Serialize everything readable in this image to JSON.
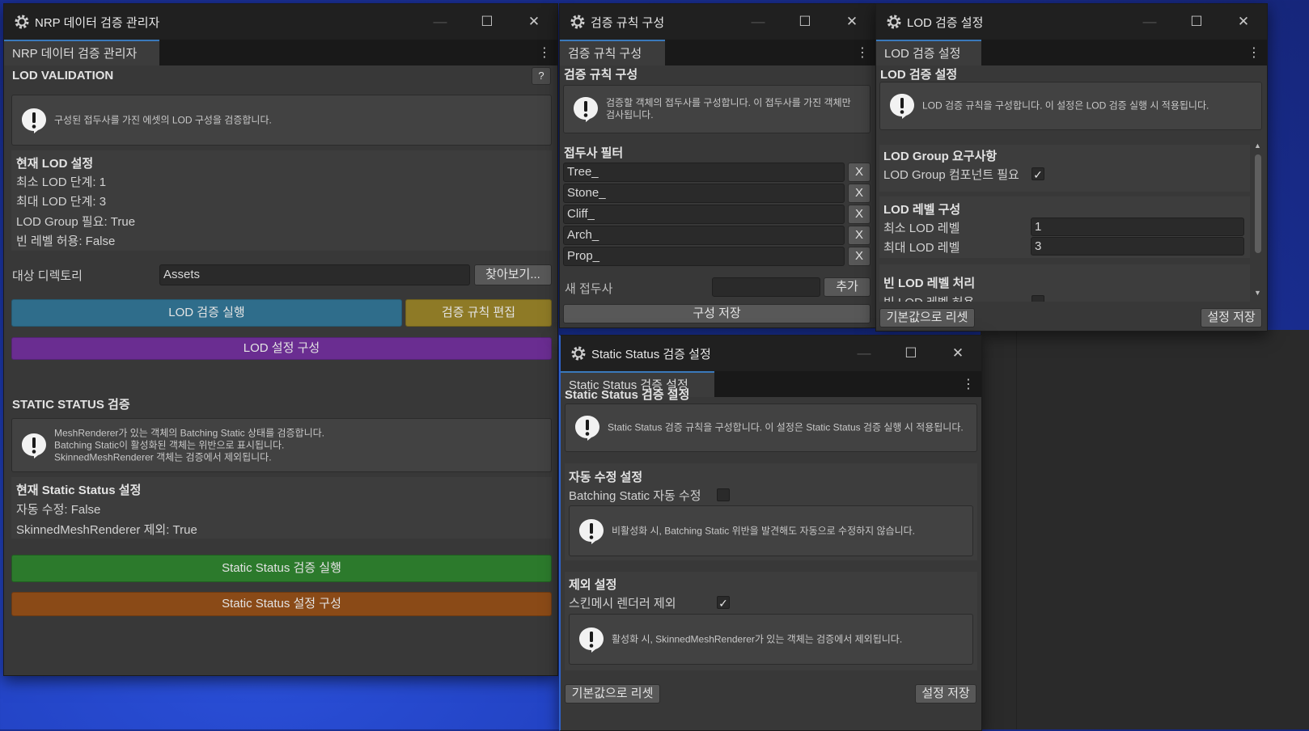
{
  "icons": {
    "app": "unity-gear-icon",
    "minimize": "minimize-icon",
    "maximize": "maximize-icon",
    "close": "close-icon",
    "menu": "kebab-menu-icon",
    "info": "exclamation-icon"
  },
  "colors": {
    "lod_run": "#2f6d8b",
    "rule_edit": "#8e7a26",
    "lod_config": "#6a2d91",
    "static_run": "#2c7a2c",
    "static_config": "#8a4a17"
  },
  "window_main": {
    "title": "NRP 데이터 검증 관리자",
    "tab": "NRP 데이터 검증 관리자",
    "lod_section": "LOD VALIDATION",
    "help_button": "?",
    "lod_info": "구성된 접두사를 가진 에셋의 LOD 구성을 검증합니다.",
    "current_lod_header": "현재 LOD 설정",
    "current_lod_lines": [
      "최소 LOD 단계: 1",
      "최대 LOD 단계: 3",
      "LOD Group 필요: True",
      "빈 레벨 허용: False"
    ],
    "target_dir_label": "대상 디렉토리",
    "target_dir_value": "Assets",
    "browse_button": "찾아보기...",
    "lod_run_button": "LOD 검증 실행",
    "rule_edit_button": "검증 규칙 편집",
    "lod_config_button": "LOD 설정 구성",
    "static_section": "STATIC STATUS 검증",
    "static_info_lines": [
      "MeshRenderer가 있는 객체의 Batching Static 상태를 검증합니다.",
      "Batching Static이 활성화된 객체는 위반으로 표시됩니다.",
      "SkinnedMeshRenderer 객체는 검증에서 제외됩니다."
    ],
    "current_static_header": "현재 Static Status 설정",
    "current_static_lines": [
      "자동 수정: False",
      "SkinnedMeshRenderer 제외: True"
    ],
    "static_run_button": "Static Status 검증 실행",
    "static_config_button": "Static Status 설정 구성"
  },
  "window_rules": {
    "title": "검증 규칙 구성",
    "tab": "검증 규칙 구성",
    "header": "검증 규칙 구성",
    "info": "검증할 객체의 접두사를 구성합니다. 이 접두사를 가진 객체만 검사됩니다.",
    "prefix_header": "접두사 필터",
    "prefixes": [
      "Tree_",
      "Stone_",
      "Cliff_",
      "Arch_",
      "Prop_"
    ],
    "remove_label": "X",
    "new_prefix_label": "새 접두사",
    "new_prefix_value": "",
    "add_button": "추가",
    "save_button": "구성 저장"
  },
  "window_lod": {
    "title": "LOD 검증 설정",
    "tab": "LOD 검증 설정",
    "header": "LOD 검증 설정",
    "info": "LOD 검증 규칙을 구성합니다. 이 설정은 LOD 검증 실행 시 적용됩니다.",
    "group_req_header": "LOD Group 요구사항",
    "group_req_label": "LOD Group 컴포넌트 필요",
    "group_req_checked": true,
    "levels_header": "LOD 레벨 구성",
    "min_label": "최소 LOD 레벨",
    "min_value": "1",
    "max_label": "최대 LOD 레벨",
    "max_value": "3",
    "empty_header": "빈 LOD 레벨 처리",
    "empty_label": "빈 LOD 레벨 허용",
    "empty_checked": false,
    "reset_button": "기본값으로 리셋",
    "save_button": "설정 저장"
  },
  "window_static": {
    "title": "Static Status 검증 설정",
    "tab": "Static Status 검증 설정",
    "header": "Static Status 검증 설정",
    "info": "Static Status 검증 규칙을 구성합니다. 이 설정은 Static Status 검증 실행 시 적용됩니다.",
    "autofix_header": "자동 수정 설정",
    "autofix_label": "Batching Static 자동 수정",
    "autofix_checked": false,
    "autofix_info": "비활성화 시, Batching Static 위반을 발견해도 자동으로 수정하지 않습니다.",
    "exclude_header": "제외 설정",
    "exclude_label": "스킨메시 렌더러 제외",
    "exclude_checked": true,
    "exclude_info": "활성화 시, SkinnedMeshRenderer가 있는 객체는 검증에서 제외됩니다.",
    "reset_button": "기본값으로 리셋",
    "save_button": "설정 저장"
  }
}
